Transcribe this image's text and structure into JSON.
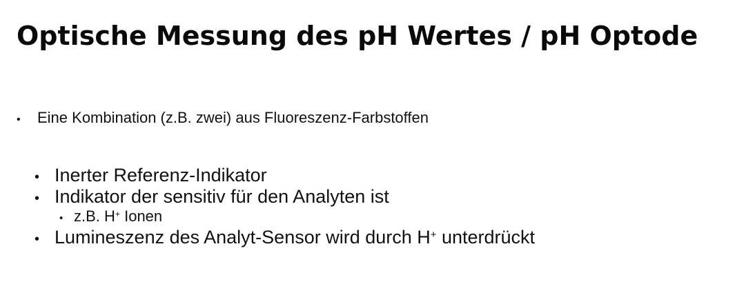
{
  "slide": {
    "title": "Optische Messung des pH Wertes / pH Optode",
    "bullet_symbol": "•",
    "intro": "Eine Kombination (z.B. zwei) aus Fluoreszenz-Farbstoffen",
    "items": [
      {
        "text": "Inerter Referenz-Indikator"
      },
      {
        "text": "Indikator der sensitiv für den Analyten ist"
      },
      {
        "prefix": "z.B. H",
        "sup": "+",
        "suffix": " Ionen"
      },
      {
        "prefix": "Lumineszenz des Analyt-Sensor wird durch H",
        "sup": "+",
        "suffix": " unterdrückt"
      }
    ]
  }
}
